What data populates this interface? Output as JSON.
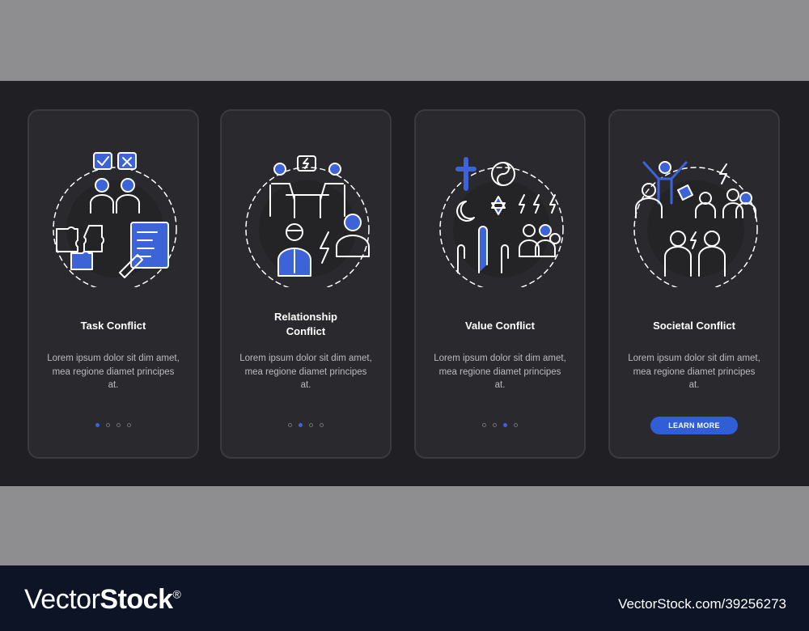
{
  "cards": [
    {
      "title": "Task Conflict",
      "description": "Lorem ipsum dolor sit dim amet, mea regione diamet principes at.",
      "active_dot": 1
    },
    {
      "title": "Relationship Conflict",
      "description": "Lorem ipsum dolor sit dim amet, mea regione diamet principes at.",
      "active_dot": 2
    },
    {
      "title": "Value Conflict",
      "description": "Lorem ipsum dolor sit dim amet, mea regione diamet principes at.",
      "active_dot": 3
    },
    {
      "title": "Societal Conflict",
      "description": "Lorem ipsum dolor sit dim amet, mea regione diamet principes at.",
      "button_label": "LEARN MORE"
    }
  ],
  "dots_total": 4,
  "footer": {
    "brand_name": "VectorStock",
    "brand_mark": "®",
    "image_id": "VectorStock.com/39256273"
  },
  "colors": {
    "accent": "#3d63d8",
    "icon_stroke": "#ffffff",
    "card_bg": "#2a2a2e",
    "stage_bg": "#202024"
  },
  "icons": [
    "task-conflict-illustration",
    "relationship-conflict-illustration",
    "value-conflict-illustration",
    "societal-conflict-illustration"
  ]
}
